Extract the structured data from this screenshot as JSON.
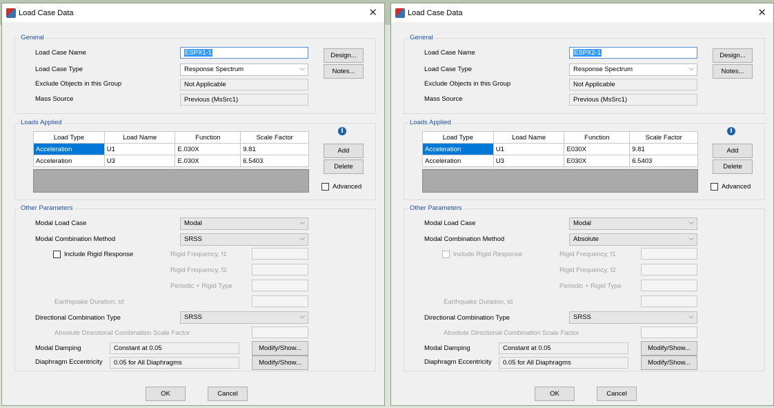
{
  "windows": [
    {
      "title": "Load Case Data",
      "general": {
        "title": "General",
        "load_case_name_label": "Load Case Name",
        "load_case_name": "ESPX1-1",
        "load_case_type_label": "Load Case Type",
        "load_case_type": "Response Spectrum",
        "exclude_label": "Exclude Objects in this Group",
        "exclude_value": "Not Applicable",
        "mass_source_label": "Mass Source",
        "mass_source": "Previous (MsSrc1)",
        "design_button": "Design...",
        "notes_button": "Notes..."
      },
      "loads": {
        "title": "Loads Applied",
        "columns": [
          "Load Type",
          "Load Name",
          "Function",
          "Scale Factor"
        ],
        "rows": [
          [
            "Acceleration",
            "U1",
            "E.030X",
            "9.81"
          ],
          [
            "Acceleration",
            "U3",
            "E.030X",
            "6.5403"
          ]
        ],
        "add_button": "Add",
        "delete_button": "Delete",
        "advanced_label": "Advanced"
      },
      "other": {
        "title": "Other Parameters",
        "modal_load_case_label": "Modal Load Case",
        "modal_load_case": "Modal",
        "modal_combination_label": "Modal Combination Method",
        "modal_combination": "SRSS",
        "include_rigid_label": "Include Rigid Response",
        "rigid_f1_label": "Rigid Frequency, f1",
        "rigid_f2_label": "Rigid Frequency, f2",
        "periodic_label": "Periodic + Rigid Type",
        "earthquake_label": "Earthquake Duration, td",
        "directional_label": "Directional Combination Type",
        "directional": "SRSS",
        "abs_dir_label": "Absolute Directional Combination Scale Factor",
        "modal_damping_label": "Modal Damping",
        "modal_damping": "Constant at 0.05",
        "diaphragm_label": "Diaphragm Eccentricity",
        "diaphragm": "0.05 for All Diaphragms",
        "modify_button": "Modify/Show..."
      },
      "ok_button": "OK",
      "cancel_button": "Cancel"
    },
    {
      "title": "Load Case Data",
      "general": {
        "title": "General",
        "load_case_name_label": "Load Case Name",
        "load_case_name": "ESPX2-1",
        "load_case_type_label": "Load Case Type",
        "load_case_type": "Response Spectrum",
        "exclude_label": "Exclude Objects in this Group",
        "exclude_value": "Not Applicable",
        "mass_source_label": "Mass Source",
        "mass_source": "Previous (MsSrc1)",
        "design_button": "Design...",
        "notes_button": "Notes..."
      },
      "loads": {
        "title": "Loads Applied",
        "columns": [
          "Load Type",
          "Load Name",
          "Function",
          "Scale Factor"
        ],
        "rows": [
          [
            "Acceleration",
            "U1",
            "E030X",
            "9.81"
          ],
          [
            "Acceleration",
            "U3",
            "E030X",
            "6.5403"
          ]
        ],
        "add_button": "Add",
        "delete_button": "Delete",
        "advanced_label": "Advanced"
      },
      "other": {
        "title": "Other Parameters",
        "modal_load_case_label": "Modal Load Case",
        "modal_load_case": "Modal",
        "modal_combination_label": "Modal Combination Method",
        "modal_combination": "Absolute",
        "include_rigid_label": "Include Rigid Response",
        "rigid_f1_label": "Rigid Frequency, f1",
        "rigid_f2_label": "Rigid Frequency, f2",
        "periodic_label": "Periodic + Rigid Type",
        "earthquake_label": "Earthquake Duration, td",
        "directional_label": "Directional Combination Type",
        "directional": "SRSS",
        "abs_dir_label": "Absolute Directional Combination Scale Factor",
        "modal_damping_label": "Modal Damping",
        "modal_damping": "Constant at 0.05",
        "diaphragm_label": "Diaphragm Eccentricity",
        "diaphragm": "0.05 for All Diaphragms",
        "modify_button": "Modify/Show..."
      },
      "ok_button": "OK",
      "cancel_button": "Cancel"
    }
  ],
  "icons": {
    "app": "load-case-app-icon",
    "close": "close-icon",
    "info": "info-icon",
    "dropdown": "chevron-down-icon"
  }
}
